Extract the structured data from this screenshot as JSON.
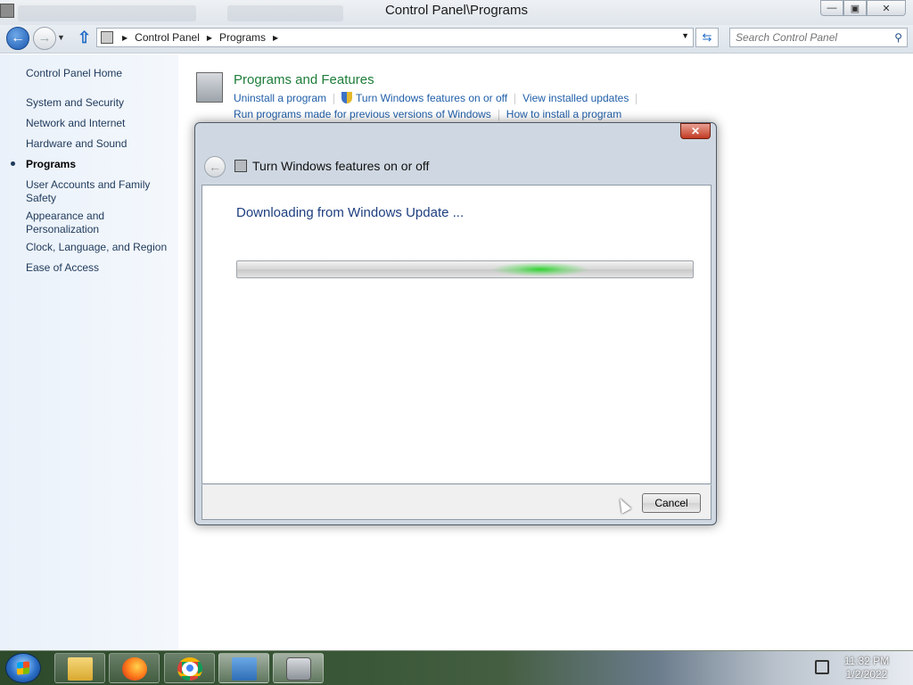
{
  "window": {
    "title": "Control Panel\\Programs",
    "controls": {
      "minimize": "—",
      "maximize": "▣",
      "close": "✕"
    }
  },
  "navbar": {
    "back_glyph": "←",
    "forward_glyph": "→",
    "up_glyph": "⇧",
    "breadcrumb": [
      "Control Panel",
      "Programs"
    ],
    "search_placeholder": "Search Control Panel",
    "icons": [
      "back-icon",
      "forward-icon",
      "up-icon",
      "refresh-icon",
      "search-icon"
    ]
  },
  "sidebar": {
    "home": "Control Panel Home",
    "items": [
      {
        "label": "System and Security",
        "active": false
      },
      {
        "label": "Network and Internet",
        "active": false
      },
      {
        "label": "Hardware and Sound",
        "active": false
      },
      {
        "label": "Programs",
        "active": true
      },
      {
        "label": "User Accounts and Family Safety",
        "active": false
      },
      {
        "label": "Appearance and Personalization",
        "active": false
      },
      {
        "label": "Clock, Language, and Region",
        "active": false
      },
      {
        "label": "Ease of Access",
        "active": false
      }
    ]
  },
  "main": {
    "section_title": "Programs and Features",
    "links_row1": [
      "Uninstall a program",
      "Turn Windows features on or off",
      "View installed updates"
    ],
    "links_row2": [
      "Run programs made for previous versions of Windows",
      "How to install a program"
    ]
  },
  "dialog": {
    "title": "Turn Windows features on or off",
    "status": "Downloading from Windows Update ...",
    "cancel_label": "Cancel",
    "close_glyph": "✕",
    "progress_state": "indeterminate"
  },
  "taskbar": {
    "pinned": [
      "windows-explorer",
      "firefox",
      "chrome",
      "control-panel",
      "windows-features"
    ],
    "clock_time": "11:32 PM",
    "clock_date": "1/2/2022"
  },
  "colors": {
    "link": "#1f5ea8",
    "section_title": "#1e7d3a",
    "status_text": "#1e3f80",
    "progress_glow": "#28d228"
  }
}
